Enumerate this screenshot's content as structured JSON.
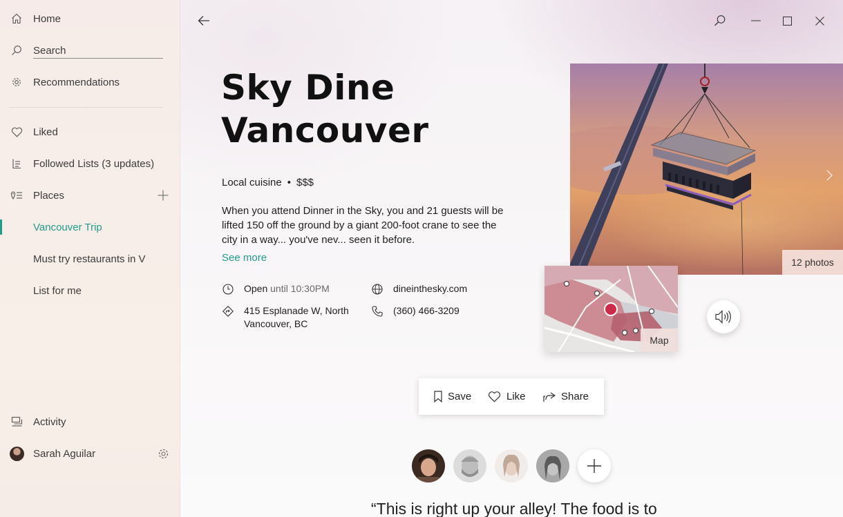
{
  "sidebar": {
    "home": "Home",
    "search_placeholder": "Search",
    "recommendations": "Recommendations",
    "liked": "Liked",
    "followed_lists": "Followed Lists (3 updates)",
    "places": "Places",
    "places_items": [
      "Vancouver Trip",
      "Must try restaurants in V",
      "List for me"
    ],
    "activity": "Activity",
    "user_name": "Sarah Aguilar"
  },
  "place": {
    "title": "Sky Dine Vancouver",
    "category": "Local cuisine",
    "separator": "•",
    "price": "$$$",
    "description": "When you attend Dinner in the Sky, you and 21 guests will be lifted 150 off the ground by a giant 200-foot crane to see the city in a way... you've nev... seen it before.",
    "see_more": "See more",
    "status_open": "Open",
    "hours": "until 10:30PM",
    "address": "415 Esplanade W, North Vancouver, BC",
    "website": "dineinthesky.com",
    "phone": "(360) 466-3209",
    "photo_count": "12 photos",
    "map_label": "Map"
  },
  "actions": {
    "save": "Save",
    "like": "Like",
    "share": "Share"
  },
  "comment": {
    "text": "“This is right up your alley! The food is to"
  },
  "colors": {
    "accent": "#1f9c8a",
    "map_marker": "#d0294a"
  },
  "icons": {
    "home": "home-icon",
    "search": "search-icon",
    "recommendations": "gear-icon",
    "liked": "heart-icon",
    "followed": "list-icon",
    "places": "location-list-icon",
    "add": "plus-icon",
    "activity": "chat-icon",
    "settings": "gear-icon",
    "back": "arrow-left-icon",
    "window_search": "search-icon",
    "minimize": "minimize-icon",
    "maximize": "maximize-icon",
    "close": "close-icon",
    "clock": "clock-icon",
    "directions": "directions-icon",
    "globe": "globe-icon",
    "phone": "phone-icon",
    "bookmark": "bookmark-icon",
    "share": "share-icon",
    "audio": "speaker-icon"
  }
}
